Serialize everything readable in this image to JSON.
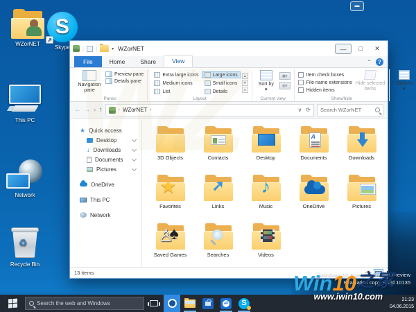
{
  "desktop": {
    "icons": [
      {
        "label": "WZorNET"
      },
      {
        "label": "Skype"
      },
      {
        "label": "This PC"
      },
      {
        "label": "Network"
      },
      {
        "label": "Recycle Bin"
      }
    ]
  },
  "window": {
    "title": "WZorNET",
    "tabs": {
      "file": "File",
      "home": "Home",
      "share": "Share",
      "view": "View"
    },
    "help": "?",
    "ribbon": {
      "panes": {
        "caption": "Panes",
        "navigation": "Navigation pane",
        "preview": "Preview pane",
        "details": "Details pane"
      },
      "layout": {
        "caption": "Layout",
        "items": [
          "Extra large icons",
          "Large icons",
          "Medium icons",
          "Small icons",
          "List",
          "Details"
        ],
        "selected": "Large icons"
      },
      "current_view": {
        "caption": "Current view",
        "sort_by": "Sort by"
      },
      "show_hide": {
        "caption": "Show/hide",
        "check1": "Item check boxes",
        "check2": "File name extensions",
        "check3": "Hidden items",
        "hide_selected": "Hide selected items"
      },
      "options": {
        "label": "Options"
      }
    },
    "address": {
      "breadcrumb": "WZorNET",
      "search_placeholder": "Search WZorNET"
    },
    "sidebar": [
      {
        "label": "Quick access"
      },
      {
        "label": "Desktop"
      },
      {
        "label": "Downloads"
      },
      {
        "label": "Documents"
      },
      {
        "label": "Pictures"
      },
      {
        "label": "OneDrive"
      },
      {
        "label": "This PC"
      },
      {
        "label": "Network"
      }
    ],
    "folders": [
      "3D Objects",
      "Contacts",
      "Desktop",
      "Documents",
      "Downloads",
      "Favorites",
      "Links",
      "Music",
      "OneDrive",
      "Pictures",
      "Saved Games",
      "Searches",
      "Videos"
    ],
    "status": "13 items"
  },
  "taskbar": {
    "search_placeholder": "Search the web and Windows",
    "clock_time": "21:23",
    "clock_date": "04.06.2015"
  },
  "watermark": {
    "build_line1": "Windows 10 Enterprise Insider Preview",
    "build_line2": "Evaluation copy. Build 10135",
    "logo_part1": "Win",
    "logo_part2": "10",
    "logo_part3": "之家",
    "site_url": "www.iwin10.com"
  },
  "colors": {
    "desktop_blue": "#0a64ae",
    "taskbar": "#222933",
    "file_tab_blue": "#2b7cd3",
    "folder_yellow": "#fbce6d",
    "skype_blue": "#00aff0",
    "logo_orange": "#f7941d",
    "logo_blue": "#2da9e1"
  }
}
